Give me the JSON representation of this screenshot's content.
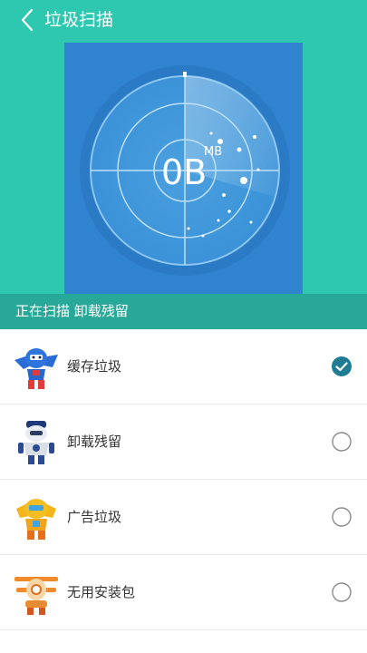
{
  "header": {
    "title": "垃圾扫描"
  },
  "scanner": {
    "size_value": "0B",
    "size_unit": "MB"
  },
  "status": {
    "text": "正在扫描 卸载残留"
  },
  "items": [
    {
      "label": "缓存垃圾",
      "checked": true,
      "icon": "robot-blue-icon"
    },
    {
      "label": "卸载残留",
      "checked": false,
      "icon": "robot-police-icon"
    },
    {
      "label": "广告垃圾",
      "checked": false,
      "icon": "robot-yellow-icon"
    },
    {
      "label": "无用安装包",
      "checked": false,
      "icon": "robot-plane-icon"
    }
  ],
  "colors": {
    "header": "#2ec8b1",
    "panel": "#2f83cf",
    "status_bar": "#27a898",
    "checked": "#1f7c93"
  }
}
